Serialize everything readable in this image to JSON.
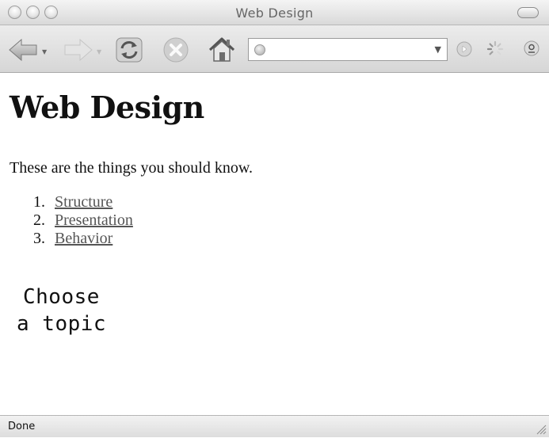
{
  "window": {
    "title": "Web Design"
  },
  "toolbar": {
    "icons": {
      "back": "arrow-left-icon",
      "forward": "arrow-right-icon",
      "reload": "reload-icon",
      "stop": "stop-icon",
      "home": "home-icon",
      "go": "go-icon",
      "activity": "spinner-icon",
      "search": "search-icon"
    },
    "address": {
      "value": "",
      "placeholder": ""
    }
  },
  "page": {
    "heading": "Web Design",
    "intro": "These are the things you should know.",
    "topics": [
      {
        "number": "1.",
        "label": "Structure"
      },
      {
        "number": "2.",
        "label": "Presentation"
      },
      {
        "number": "3.",
        "label": "Behavior"
      }
    ],
    "choose_line1": "Choose",
    "choose_line2": "a topic"
  },
  "status": {
    "text": "Done"
  }
}
